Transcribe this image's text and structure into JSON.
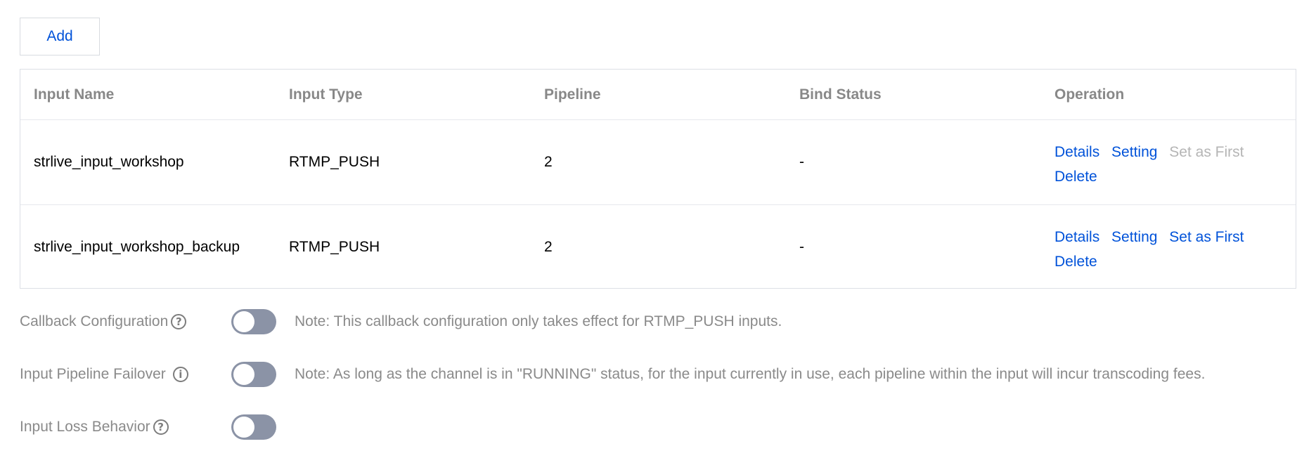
{
  "toolbar": {
    "add_label": "Add"
  },
  "table": {
    "headers": [
      "Input Name",
      "Input Type",
      "Pipeline",
      "Bind Status",
      "Operation"
    ],
    "rows": [
      {
        "input_name": "strlive_input_workshop",
        "input_type": "RTMP_PUSH",
        "pipeline": "2",
        "bind_status": "-",
        "ops": {
          "details": "Details",
          "setting": "Setting",
          "set_first": "Set as First",
          "set_first_enabled": false,
          "delete": "Delete"
        }
      },
      {
        "input_name": "strlive_input_workshop_backup",
        "input_type": "RTMP_PUSH",
        "pipeline": "2",
        "bind_status": "-",
        "ops": {
          "details": "Details",
          "setting": "Setting",
          "set_first": "Set as First",
          "set_first_enabled": true,
          "delete": "Delete"
        }
      }
    ]
  },
  "settings": [
    {
      "label": "Callback Configuration",
      "icon": "question-circle-icon",
      "icon_glyph": "?",
      "enabled": false,
      "note": "Note: This callback configuration only takes effect for RTMP_PUSH inputs."
    },
    {
      "label": "Input Pipeline Failover",
      "icon": "info-circle-icon",
      "icon_glyph": "i",
      "enabled": false,
      "note": "Note: As long as the channel is in \"RUNNING\" status, for the input currently in use, each pipeline within the input will incur transcoding fees."
    },
    {
      "label": "Input Loss Behavior",
      "icon": "question-circle-icon",
      "icon_glyph": "?",
      "enabled": false,
      "note": ""
    }
  ],
  "colors": {
    "link": "#0052d9",
    "disabled_link": "#b5b5b5",
    "toggle_off": "#8b93a6",
    "muted_text": "#8a8a8a"
  }
}
